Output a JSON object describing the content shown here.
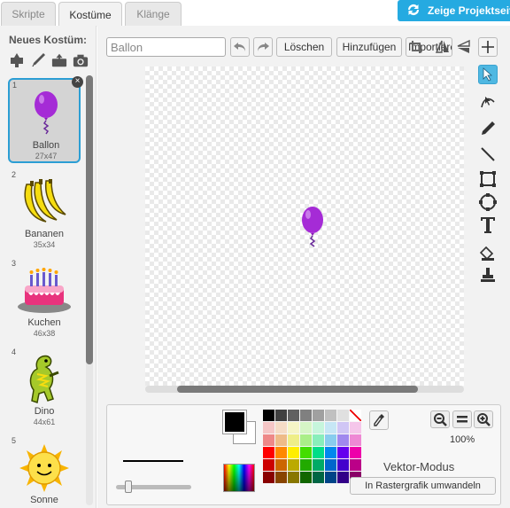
{
  "tabs": [
    {
      "label": "Skripte",
      "active": false
    },
    {
      "label": "Kostüme",
      "active": true
    },
    {
      "label": "Klänge",
      "active": false
    }
  ],
  "project_button": {
    "label": "Zeige Projektseite"
  },
  "left": {
    "heading": "Neues Kostüm:",
    "tools": [
      "paint-from-library-icon",
      "paint-brush-icon",
      "upload-icon",
      "camera-icon"
    ],
    "costumes": [
      {
        "num": "1",
        "name": "Ballon",
        "size": "27x47",
        "selected": true
      },
      {
        "num": "2",
        "name": "Bananen",
        "size": "35x34",
        "selected": false
      },
      {
        "num": "3",
        "name": "Kuchen",
        "size": "46x38",
        "selected": false
      },
      {
        "num": "4",
        "name": "Dino",
        "size": "44x61",
        "selected": false
      },
      {
        "num": "5",
        "name": "Sonne",
        "size": "",
        "selected": false
      }
    ]
  },
  "editor": {
    "costume_name": "Ballon",
    "clear_label": "Löschen",
    "add_label": "Hinzufügen",
    "import_label": "Importieren",
    "zoom_label": "100%",
    "mode_label": "Vektor-Modus",
    "convert_label": "In Rastergrafik umwandeln"
  },
  "colors": {
    "accent": "#25aae1",
    "selected_border": "#2b9ed4",
    "balloon": "#a52bd6",
    "primary": "#000000",
    "secondary": "#ffffff",
    "palette": [
      "#000000",
      "#404040",
      "#606060",
      "#808080",
      "#a0a0a0",
      "#c0c0c0",
      "#e0e0e0",
      "#ffffff",
      "#f5c6c6",
      "#f5dcc6",
      "#f5f5c6",
      "#d6f5c6",
      "#c6f5dc",
      "#c6e6f5",
      "#d0c6f5",
      "#f5c6ea",
      "#ee8888",
      "#eebb88",
      "#eeee88",
      "#aaee88",
      "#88eebb",
      "#88ccee",
      "#a088ee",
      "#ee88d4",
      "#ff0000",
      "#ff8800",
      "#ffee00",
      "#44dd00",
      "#00dd88",
      "#0088ee",
      "#6600ee",
      "#ee00aa",
      "#cc0000",
      "#cc6600",
      "#bbaa00",
      "#22aa00",
      "#00aa66",
      "#0066cc",
      "#4400cc",
      "#bb0088",
      "#880000",
      "#884400",
      "#887700",
      "#116600",
      "#006644",
      "#004488",
      "#330088",
      "#880066"
    ]
  }
}
